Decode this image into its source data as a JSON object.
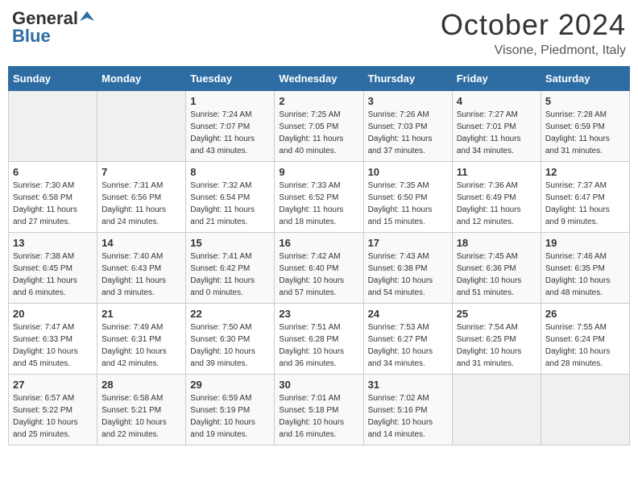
{
  "header": {
    "logo_line1": "General",
    "logo_line2": "Blue",
    "month_title": "October 2024",
    "subtitle": "Visone, Piedmont, Italy"
  },
  "days_of_week": [
    "Sunday",
    "Monday",
    "Tuesday",
    "Wednesday",
    "Thursday",
    "Friday",
    "Saturday"
  ],
  "weeks": [
    [
      {
        "day": "",
        "sunrise": "",
        "sunset": "",
        "daylight": ""
      },
      {
        "day": "",
        "sunrise": "",
        "sunset": "",
        "daylight": ""
      },
      {
        "day": "1",
        "sunrise": "Sunrise: 7:24 AM",
        "sunset": "Sunset: 7:07 PM",
        "daylight": "Daylight: 11 hours and 43 minutes."
      },
      {
        "day": "2",
        "sunrise": "Sunrise: 7:25 AM",
        "sunset": "Sunset: 7:05 PM",
        "daylight": "Daylight: 11 hours and 40 minutes."
      },
      {
        "day": "3",
        "sunrise": "Sunrise: 7:26 AM",
        "sunset": "Sunset: 7:03 PM",
        "daylight": "Daylight: 11 hours and 37 minutes."
      },
      {
        "day": "4",
        "sunrise": "Sunrise: 7:27 AM",
        "sunset": "Sunset: 7:01 PM",
        "daylight": "Daylight: 11 hours and 34 minutes."
      },
      {
        "day": "5",
        "sunrise": "Sunrise: 7:28 AM",
        "sunset": "Sunset: 6:59 PM",
        "daylight": "Daylight: 11 hours and 31 minutes."
      }
    ],
    [
      {
        "day": "6",
        "sunrise": "Sunrise: 7:30 AM",
        "sunset": "Sunset: 6:58 PM",
        "daylight": "Daylight: 11 hours and 27 minutes."
      },
      {
        "day": "7",
        "sunrise": "Sunrise: 7:31 AM",
        "sunset": "Sunset: 6:56 PM",
        "daylight": "Daylight: 11 hours and 24 minutes."
      },
      {
        "day": "8",
        "sunrise": "Sunrise: 7:32 AM",
        "sunset": "Sunset: 6:54 PM",
        "daylight": "Daylight: 11 hours and 21 minutes."
      },
      {
        "day": "9",
        "sunrise": "Sunrise: 7:33 AM",
        "sunset": "Sunset: 6:52 PM",
        "daylight": "Daylight: 11 hours and 18 minutes."
      },
      {
        "day": "10",
        "sunrise": "Sunrise: 7:35 AM",
        "sunset": "Sunset: 6:50 PM",
        "daylight": "Daylight: 11 hours and 15 minutes."
      },
      {
        "day": "11",
        "sunrise": "Sunrise: 7:36 AM",
        "sunset": "Sunset: 6:49 PM",
        "daylight": "Daylight: 11 hours and 12 minutes."
      },
      {
        "day": "12",
        "sunrise": "Sunrise: 7:37 AM",
        "sunset": "Sunset: 6:47 PM",
        "daylight": "Daylight: 11 hours and 9 minutes."
      }
    ],
    [
      {
        "day": "13",
        "sunrise": "Sunrise: 7:38 AM",
        "sunset": "Sunset: 6:45 PM",
        "daylight": "Daylight: 11 hours and 6 minutes."
      },
      {
        "day": "14",
        "sunrise": "Sunrise: 7:40 AM",
        "sunset": "Sunset: 6:43 PM",
        "daylight": "Daylight: 11 hours and 3 minutes."
      },
      {
        "day": "15",
        "sunrise": "Sunrise: 7:41 AM",
        "sunset": "Sunset: 6:42 PM",
        "daylight": "Daylight: 11 hours and 0 minutes."
      },
      {
        "day": "16",
        "sunrise": "Sunrise: 7:42 AM",
        "sunset": "Sunset: 6:40 PM",
        "daylight": "Daylight: 10 hours and 57 minutes."
      },
      {
        "day": "17",
        "sunrise": "Sunrise: 7:43 AM",
        "sunset": "Sunset: 6:38 PM",
        "daylight": "Daylight: 10 hours and 54 minutes."
      },
      {
        "day": "18",
        "sunrise": "Sunrise: 7:45 AM",
        "sunset": "Sunset: 6:36 PM",
        "daylight": "Daylight: 10 hours and 51 minutes."
      },
      {
        "day": "19",
        "sunrise": "Sunrise: 7:46 AM",
        "sunset": "Sunset: 6:35 PM",
        "daylight": "Daylight: 10 hours and 48 minutes."
      }
    ],
    [
      {
        "day": "20",
        "sunrise": "Sunrise: 7:47 AM",
        "sunset": "Sunset: 6:33 PM",
        "daylight": "Daylight: 10 hours and 45 minutes."
      },
      {
        "day": "21",
        "sunrise": "Sunrise: 7:49 AM",
        "sunset": "Sunset: 6:31 PM",
        "daylight": "Daylight: 10 hours and 42 minutes."
      },
      {
        "day": "22",
        "sunrise": "Sunrise: 7:50 AM",
        "sunset": "Sunset: 6:30 PM",
        "daylight": "Daylight: 10 hours and 39 minutes."
      },
      {
        "day": "23",
        "sunrise": "Sunrise: 7:51 AM",
        "sunset": "Sunset: 6:28 PM",
        "daylight": "Daylight: 10 hours and 36 minutes."
      },
      {
        "day": "24",
        "sunrise": "Sunrise: 7:53 AM",
        "sunset": "Sunset: 6:27 PM",
        "daylight": "Daylight: 10 hours and 34 minutes."
      },
      {
        "day": "25",
        "sunrise": "Sunrise: 7:54 AM",
        "sunset": "Sunset: 6:25 PM",
        "daylight": "Daylight: 10 hours and 31 minutes."
      },
      {
        "day": "26",
        "sunrise": "Sunrise: 7:55 AM",
        "sunset": "Sunset: 6:24 PM",
        "daylight": "Daylight: 10 hours and 28 minutes."
      }
    ],
    [
      {
        "day": "27",
        "sunrise": "Sunrise: 6:57 AM",
        "sunset": "Sunset: 5:22 PM",
        "daylight": "Daylight: 10 hours and 25 minutes."
      },
      {
        "day": "28",
        "sunrise": "Sunrise: 6:58 AM",
        "sunset": "Sunset: 5:21 PM",
        "daylight": "Daylight: 10 hours and 22 minutes."
      },
      {
        "day": "29",
        "sunrise": "Sunrise: 6:59 AM",
        "sunset": "Sunset: 5:19 PM",
        "daylight": "Daylight: 10 hours and 19 minutes."
      },
      {
        "day": "30",
        "sunrise": "Sunrise: 7:01 AM",
        "sunset": "Sunset: 5:18 PM",
        "daylight": "Daylight: 10 hours and 16 minutes."
      },
      {
        "day": "31",
        "sunrise": "Sunrise: 7:02 AM",
        "sunset": "Sunset: 5:16 PM",
        "daylight": "Daylight: 10 hours and 14 minutes."
      },
      {
        "day": "",
        "sunrise": "",
        "sunset": "",
        "daylight": ""
      },
      {
        "day": "",
        "sunrise": "",
        "sunset": "",
        "daylight": ""
      }
    ]
  ]
}
